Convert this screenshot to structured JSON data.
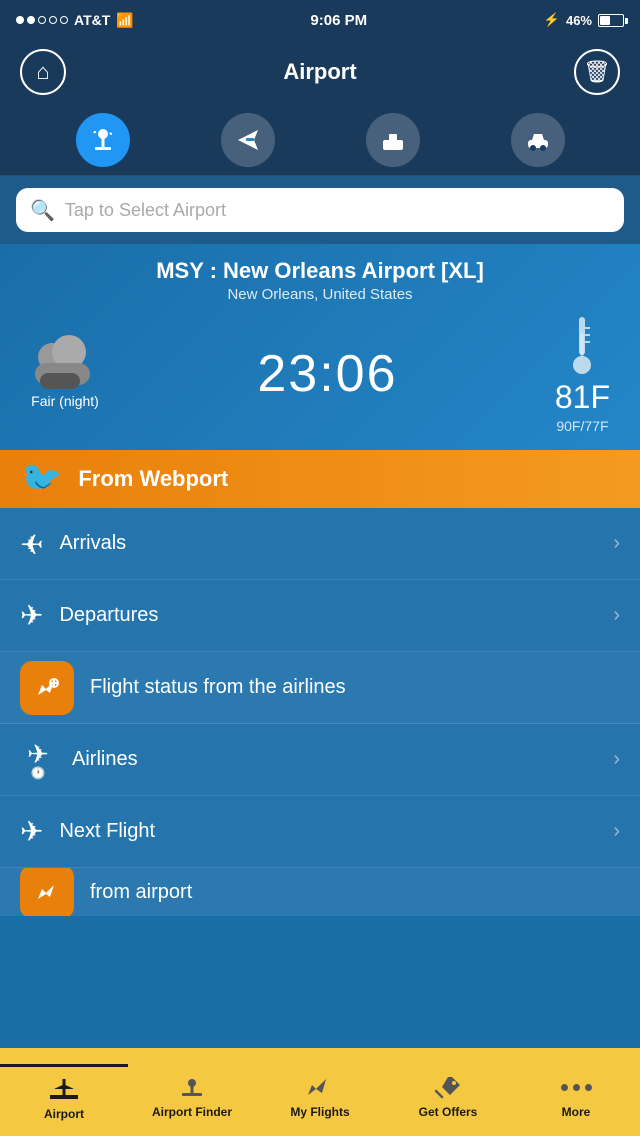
{
  "status_bar": {
    "carrier": "AT&T",
    "time": "9:06 PM",
    "battery": "46%",
    "signal_dots": [
      true,
      true,
      false,
      false,
      false
    ]
  },
  "nav": {
    "title": "Airport",
    "home_icon": "home",
    "delete_icon": "trash"
  },
  "category_tabs": [
    {
      "id": "flights",
      "icon": "✈",
      "active": true
    },
    {
      "id": "send",
      "icon": "➤",
      "active": false
    },
    {
      "id": "hotel",
      "icon": "🛏",
      "active": false
    },
    {
      "id": "car",
      "icon": "🚗",
      "active": false
    }
  ],
  "search": {
    "placeholder": "Tap to Select Airport"
  },
  "airport": {
    "code": "MSY",
    "name": "New Orleans Airport [XL]",
    "city": "New Orleans, United States",
    "time": "23:06",
    "weather_desc": "Fair (night)",
    "temp_main": "81F",
    "temp_range": "90F/77F"
  },
  "webport": {
    "label": "From Webport"
  },
  "menu_items": [
    {
      "id": "arrivals",
      "label": "Arrivals",
      "icon": "✈",
      "has_chevron": true,
      "icon_type": "plain",
      "flip": true
    },
    {
      "id": "departures",
      "label": "Departures",
      "icon": "✈",
      "has_chevron": true,
      "icon_type": "plain"
    },
    {
      "id": "flight_status",
      "label": "Flight status from the airlines",
      "icon": "✈",
      "has_chevron": false,
      "icon_type": "orange"
    },
    {
      "id": "airlines",
      "label": "Airlines",
      "icon": "✈",
      "has_chevron": true,
      "icon_type": "plain"
    },
    {
      "id": "next_flight",
      "label": "Next Flight",
      "icon": "✈",
      "has_chevron": true,
      "icon_type": "plain"
    }
  ],
  "partial_item": {
    "label": "from airport",
    "icon_type": "orange"
  },
  "bottom_tabs": [
    {
      "id": "airport",
      "label": "Airport",
      "icon": "✈",
      "active": true
    },
    {
      "id": "airport_finder",
      "label": "Airport Finder",
      "icon": "🏢",
      "active": false
    },
    {
      "id": "my_flights",
      "label": "My Flights",
      "icon": "✈",
      "active": false
    },
    {
      "id": "get_offers",
      "label": "Get Offers",
      "icon": "🏷",
      "active": false
    },
    {
      "id": "more",
      "label": "More",
      "icon": "•••",
      "active": false
    }
  ]
}
